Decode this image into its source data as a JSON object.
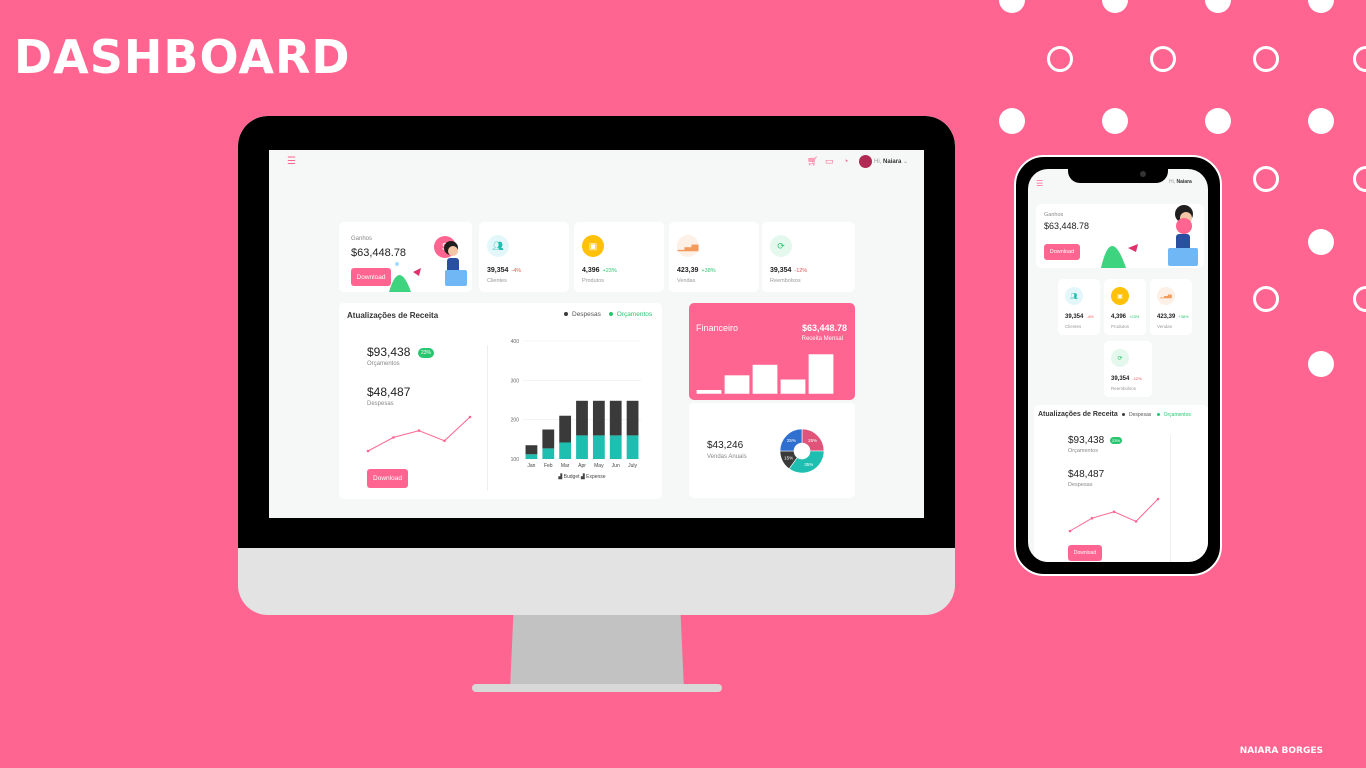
{
  "banner": {
    "title": "DASHBOARD",
    "credit": "NAIARA BORGES"
  },
  "colors": {
    "brand": "#ff6590",
    "teal": "#1ebfb0",
    "dark": "#3a3a3a",
    "green": "#28c76f",
    "red": "#ea5455",
    "yellow": "#ffc107"
  },
  "header": {
    "menu_icon": "hamburger-icon",
    "cart_icon": "cart-icon",
    "chat_icon": "chat-icon",
    "bell_icon": "bell-icon",
    "greeting": "Hi,",
    "user_name": "Naiara"
  },
  "earnings": {
    "label": "Ganhos",
    "value": "$63,448.78",
    "button": "Download",
    "badge": "$"
  },
  "stats": [
    {
      "icon": "users-icon",
      "value": "39,354",
      "change": "-4%",
      "trend": "down",
      "label": "Clientes"
    },
    {
      "icon": "box-icon",
      "value": "4,396",
      "change": "+23%",
      "trend": "up",
      "label": "Produtos"
    },
    {
      "icon": "bar-chart-icon",
      "value": "423,39",
      "change": "+38%",
      "trend": "up",
      "label": "Vendas"
    },
    {
      "icon": "refresh-icon",
      "value": "39,354",
      "change": "-12%",
      "trend": "down",
      "label": "Reembolsos"
    }
  ],
  "revenue": {
    "title": "Atualizações de Receita",
    "legend": [
      {
        "label": "Despesas",
        "color": "#3a3a3a"
      },
      {
        "label": "Orçamentos",
        "color": "#28c76f"
      }
    ],
    "budget_value": "$93,438",
    "budget_badge": "23%",
    "budget_label": "Orçamentos",
    "expense_value": "$48,487",
    "expense_label": "Despesas",
    "button": "Download"
  },
  "sparkline": {
    "values": [
      2,
      4,
      5,
      3.5,
      7
    ]
  },
  "financial": {
    "title": "Financeiro",
    "value": "$63,448.78",
    "label": "Receita Mensal"
  },
  "annual": {
    "value": "$43,246",
    "label": "Vendas Anuais"
  },
  "chart_data": [
    {
      "type": "bar",
      "categories": [
        "Jan",
        "Feb",
        "Mar",
        "Apr",
        "May",
        "Jun",
        "July"
      ],
      "y_ticks": [
        100,
        200,
        300,
        400
      ],
      "ylim": [
        100,
        400
      ],
      "stacked": true,
      "series": [
        {
          "name": "Budget",
          "color": "#1ebfb0",
          "values": [
            112,
            127,
            142,
            160,
            160,
            160,
            160
          ]
        },
        {
          "name": "Expense",
          "color": "#3a3a3a",
          "values": [
            123,
            148,
            168,
            188,
            188,
            188,
            188
          ]
        }
      ],
      "legend": [
        "Budget",
        "Expense"
      ]
    },
    {
      "type": "bar",
      "values": [
        2,
        9,
        14,
        7,
        19
      ],
      "color": "#ffffff"
    },
    {
      "type": "pie",
      "donut": true,
      "slices": [
        {
          "label": "25%",
          "value": 25,
          "color": "#e0547a"
        },
        {
          "label": "35%",
          "value": 35,
          "color": "#1ebfb0"
        },
        {
          "label": "15%",
          "value": 15,
          "color": "#3a3a3a"
        },
        {
          "label": "25%",
          "value": 25,
          "color": "#2f6fd0"
        }
      ]
    }
  ],
  "phone": {
    "earnings_label": "Ganhos",
    "earnings_value": "$63,448.78",
    "button": "Download",
    "hi": "Hi,",
    "name": "Naiara"
  }
}
